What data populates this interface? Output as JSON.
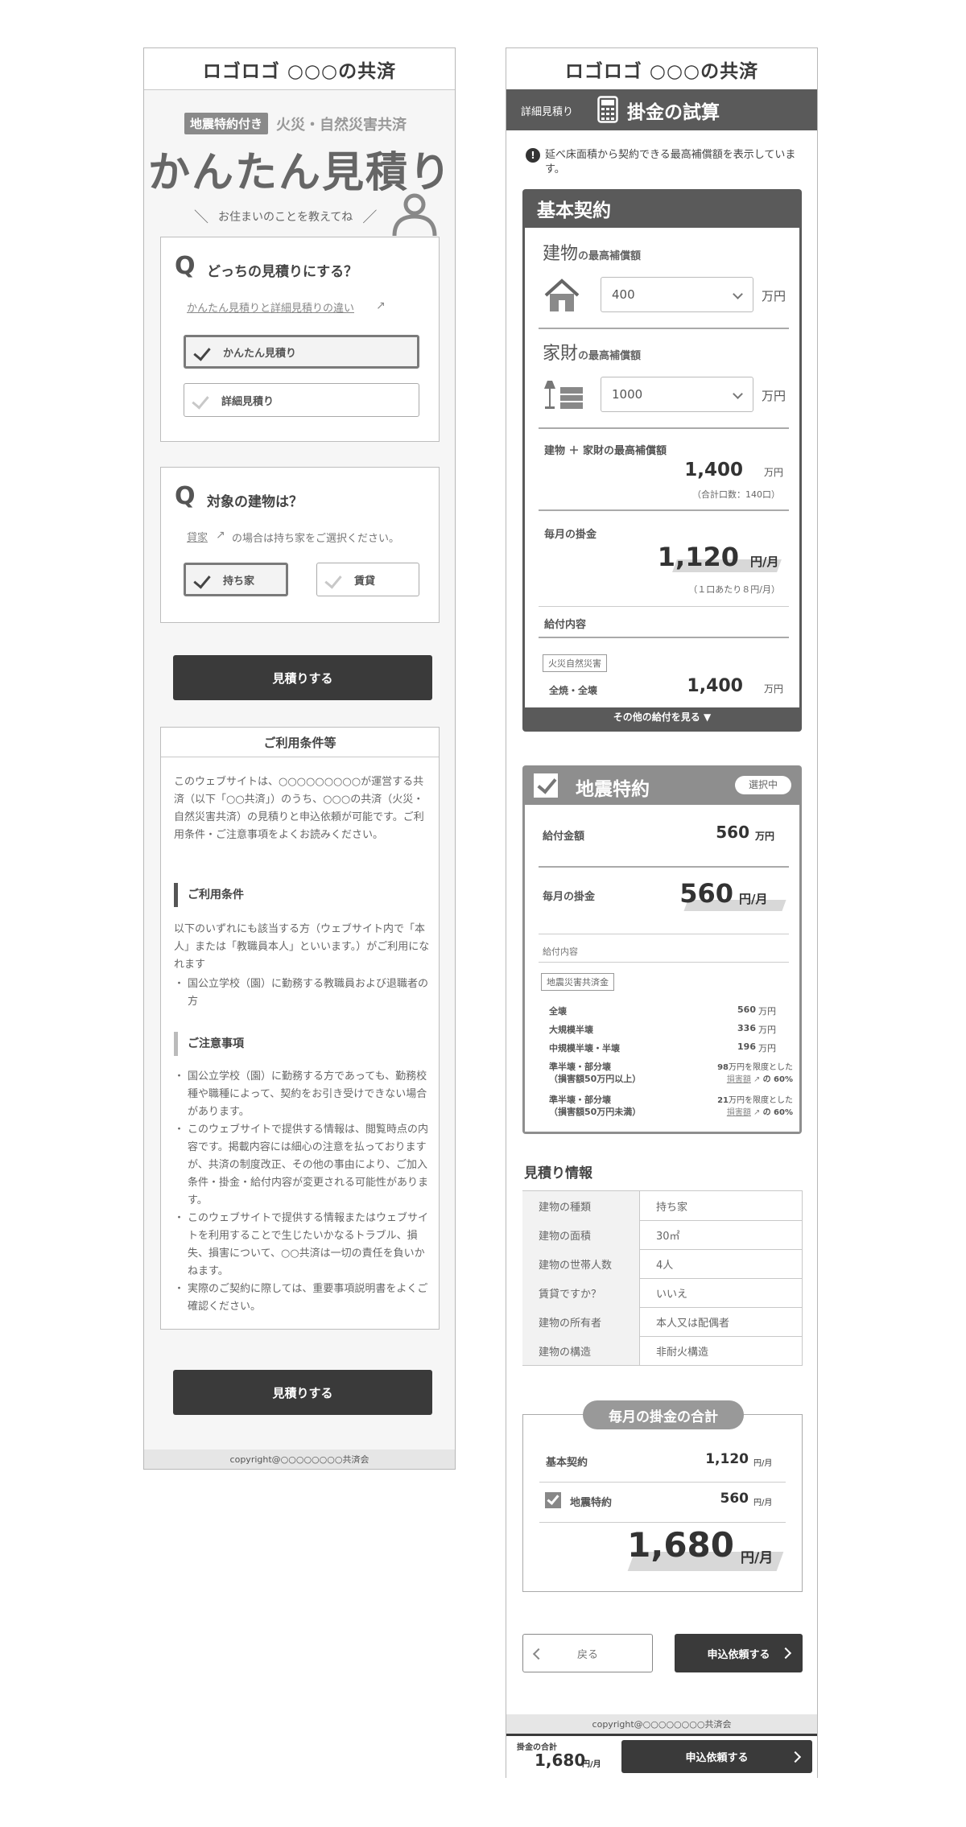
{
  "brand_title": "ロゴロゴ ○○○の共済",
  "left": {
    "hero": {
      "badge": "地震特約付き",
      "category": "火災・自然災害共済",
      "title": "かんたん見積り",
      "tagline": "お住まいのことを教えてね"
    },
    "q1": {
      "mark": "Q",
      "title": "どっちの見積りにする？",
      "link": "かんたん見積りと詳細見積りの違い",
      "options": [
        "かんたん見積り",
        "詳細見積り"
      ]
    },
    "q2": {
      "mark": "Q",
      "title": "対象の建物は？",
      "link": "貸家",
      "note": "の場合は持ち家をご選択ください。",
      "options": [
        "持ち家",
        "賃貸"
      ]
    },
    "estimate_button": "見積りする",
    "terms": {
      "title": "ご利用条件等",
      "intro": "このウェブサイトは、○○○○○○○○○が運営する共済（以下「○○共済」）のうち、○○○の共済（火災・自然災害共済）の見積りと申込依頼が可能です。ご利用条件・ご注意事項をよくお読みください。",
      "conditions_heading": "ご利用条件",
      "conditions_text": "以下のいずれにも該当する方（ウェブサイト内で「本人」または「教職員本人」といいます。）がご利用になれます",
      "conditions_bullets": [
        "国公立学校（園）に勤務する教職員および退職者の方"
      ],
      "notes_heading": "ご注意事項",
      "notes_bullets": [
        "国公立学校（園）に勤務する方であっても、勤務校種や職種によって、契約をお引き受けできない場合があります。",
        "このウェブサイトで提供する情報は、閲覧時点の内容です。掲載内容には細心の注意を払っておりますが、共済の制度改正、その他の事由により、ご加入条件・掛金・給付内容が変更される可能性があります。",
        "このウェブサイトで提供する情報またはウェブサイトを利用することで生じたいかなるトラブル、損失、損害について、○○共済は一切の責任を負いかねます。",
        "実際のご契約に際しては、重要事項説明書をよくご確認ください。"
      ]
    },
    "copyright": "copyright@○○○○○○○○共済会"
  },
  "right": {
    "bar": {
      "badge": "詳細見積り",
      "title": "掛金の試算"
    },
    "notice": "延べ床面積から契約できる最高補償額を表示しています。",
    "basic": {
      "title": "基本契約",
      "building_label": "建物",
      "building_sub": "の最高補償額",
      "building_value": "400",
      "furniture_label": "家財",
      "furniture_sub": "の最高補償額",
      "furniture_value": "1000",
      "unit_man": "万円",
      "total_label": "建物 ＋ 家財の最高補償額",
      "total_value": "1,400",
      "total_units": "（合計口数：140口）",
      "monthly_label": "毎月の掛金",
      "monthly_value": "1,120",
      "monthly_unit": "円/月",
      "per_unit": "（１口あたり８円/月）",
      "benefit_label": "給付内容",
      "benefit_tag": "火災自然災害",
      "benefit_item": "全焼・全壊",
      "benefit_value": "1,400",
      "more": "その他の給付を見る ▼"
    },
    "quake": {
      "title": "地震特約",
      "selected": "選択中",
      "amount_label": "給付金額",
      "amount_value": "560",
      "amount_unit": "万円",
      "monthly_label": "毎月の掛金",
      "monthly_value": "560",
      "monthly_unit": "円/月",
      "benefit_label": "給付内容",
      "tag": "地震災害共済金",
      "rows": [
        {
          "label": "全壊",
          "value": "560",
          "unit": "万円"
        },
        {
          "label": "大規模半壊",
          "value": "336",
          "unit": "万円"
        },
        {
          "label": "中規模半壊・半壊",
          "value": "196",
          "unit": "万円"
        }
      ],
      "partial1_label": "準半壊・部分壊",
      "partial1_sub": "（損害額50万円以上）",
      "partial1_value": "98",
      "partial2_label": "準半壊・部分壊",
      "partial2_sub": "（損害額50万円未満）",
      "partial2_value": "21",
      "limit_text": "万円を限度とした",
      "damage_link": "損害額",
      "rate_text": "の 60%"
    },
    "info": {
      "title": "見積り情報",
      "rows": [
        {
          "k": "建物の種類",
          "v": "持ち家"
        },
        {
          "k": "建物の面積",
          "v": "30㎡"
        },
        {
          "k": "建物の世帯人数",
          "v": "4人"
        },
        {
          "k": "賃貸ですか？",
          "v": "いいえ"
        },
        {
          "k": "建物の所有者",
          "v": "本人又は配偶者"
        },
        {
          "k": "建物の構造",
          "v": "非耐火構造"
        }
      ]
    },
    "summary": {
      "title": "毎月の掛金の合計",
      "basic_label": "基本契約",
      "basic_value": "1,120",
      "quake_label": "地震特約",
      "quake_value": "560",
      "unit": "円/月",
      "total": "1,680",
      "total_unit": "円/月"
    },
    "back": "戻る",
    "apply": "申込依頼する",
    "copyright": "copyright@○○○○○○○○共済会",
    "sticky": {
      "label": "掛金の合計",
      "value": "1,680",
      "unit": "円/月",
      "apply": "申込依頼する"
    }
  }
}
